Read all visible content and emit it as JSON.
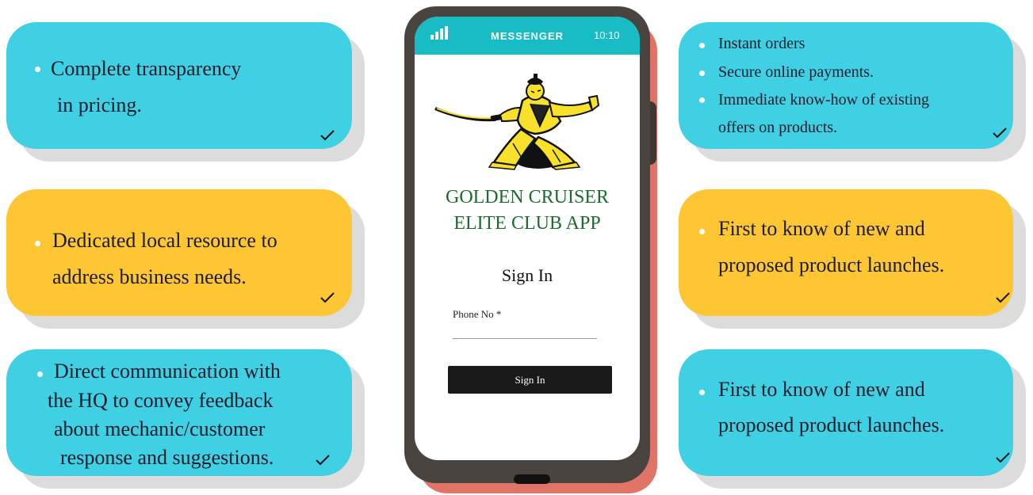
{
  "cards": {
    "left_1": {
      "lines": [
        "Complete transparency",
        "in pricing."
      ]
    },
    "left_2": {
      "lines": [
        "Dedicated local resource to",
        "address business needs."
      ]
    },
    "left_3": {
      "lines": [
        "Direct communication with",
        "the HQ to convey feedback",
        "about mechanic/customer",
        "response and suggestions."
      ]
    },
    "right_1": {
      "items": [
        "Instant orders",
        "Secure online payments.",
        "Immediate know-how of existing",
        "offers on products."
      ]
    },
    "right_2": {
      "lines": [
        "First to know of new and",
        "proposed product launches."
      ]
    },
    "right_3": {
      "lines": [
        "First to know of new and",
        "proposed product launches."
      ]
    }
  },
  "phone": {
    "status_title": "MESSENGER",
    "status_time": "10:10",
    "app_title_line1": "GOLDEN CRUISER",
    "app_title_line2": "ELITE CLUB APP",
    "signin_heading": "Sign In",
    "phone_label": "Phone No *",
    "phone_value": "",
    "signin_button": "Sign In"
  },
  "colors": {
    "blue_card": "#3fd0e4",
    "yellow_card": "#fdc632",
    "teal_status": "#18bcc4",
    "app_title_green": "#1e6a30",
    "phone_back": "#e07466",
    "phone_body": "#4a4440"
  },
  "icons": [
    "check-icon",
    "signal-bars-icon",
    "samurai-logo"
  ]
}
